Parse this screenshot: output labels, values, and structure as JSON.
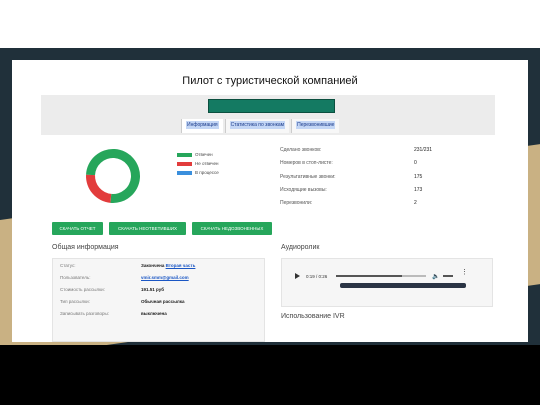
{
  "slide": {
    "title": "Пилот с туристической компанией"
  },
  "colors": {
    "accent": "#147a62",
    "button": "#26a65b",
    "answered": "#26a65b",
    "not_answered": "#e23c3c",
    "in_progress": "#3a8fdd"
  },
  "tabs": [
    {
      "label": "Информация",
      "active": true
    },
    {
      "label": "Статистика по звонкам",
      "active": false
    },
    {
      "label": "Перезвонившие",
      "active": false
    }
  ],
  "chart_data": {
    "type": "pie",
    "categories": [
      "Отвечен",
      "Не отвечен",
      "В процессе"
    ],
    "values": [
      175,
      56,
      0
    ]
  },
  "legend": [
    {
      "label": "Отвечен"
    },
    {
      "label": "Не отвечен"
    },
    {
      "label": "В процессе"
    }
  ],
  "stats": [
    {
      "label": "Сделано звонков:",
      "value": "231/231"
    },
    {
      "label": "Номеров в стоп-листе:",
      "value": "0"
    },
    {
      "label": "Результативные звонки:",
      "value": "175"
    },
    {
      "label": "Исходящие вызовы:",
      "value": "173"
    },
    {
      "label": "Перезвонили:",
      "value": "2"
    }
  ],
  "buttons": [
    {
      "label": "СКАЧАТЬ ОТЧЕТ"
    },
    {
      "label": "СКАЧАТЬ НЕОТВЕТИВШИХ"
    },
    {
      "label": "СКАЧАТЬ НЕДОЗВОНЕННЫХ"
    }
  ],
  "general": {
    "title": "Общая информация",
    "rows": [
      {
        "label": "Статус:",
        "value": "Закончена",
        "link": "Вторая часть"
      },
      {
        "label": "Пользователь:",
        "value": "",
        "link": "vmir.smm@gmail.com"
      },
      {
        "label": "Стоимость рассылки:",
        "value": "191.51 руб",
        "link": ""
      },
      {
        "label": "Тип рассылки:",
        "value": "Обычная рассылка",
        "link": ""
      },
      {
        "label": "Записывать разговоры:",
        "value": "выключена",
        "link": ""
      }
    ]
  },
  "audio": {
    "title": "Аудиоролик",
    "time": "0:19 / 0:26",
    "progress": 0.73
  },
  "ivr": {
    "title": "Использование IVR"
  }
}
